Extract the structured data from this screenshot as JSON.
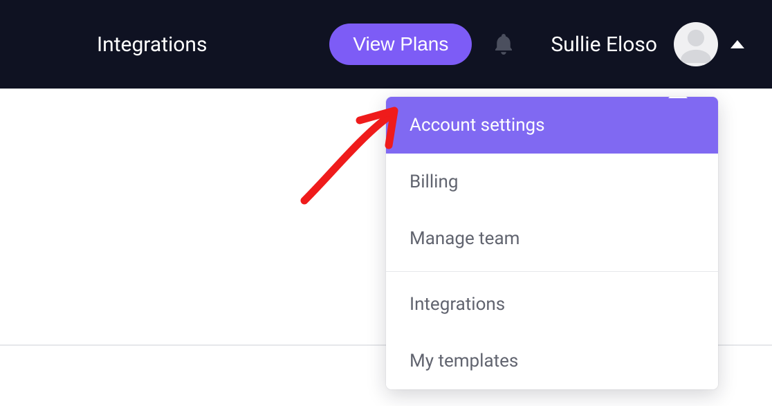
{
  "header": {
    "nav_item": "Integrations",
    "view_plans_label": "View Plans",
    "username": "Sullie Eloso"
  },
  "dropdown": {
    "items": [
      {
        "label": "Account settings",
        "active": true
      },
      {
        "label": "Billing",
        "active": false
      },
      {
        "label": "Manage team",
        "active": false
      }
    ],
    "items2": [
      {
        "label": "Integrations"
      },
      {
        "label": "My templates"
      }
    ]
  },
  "colors": {
    "accent": "#7d5cf6",
    "dropdown_active": "#8069f2",
    "header_bg": "#0f1222",
    "annotation": "#ef1b1b"
  }
}
